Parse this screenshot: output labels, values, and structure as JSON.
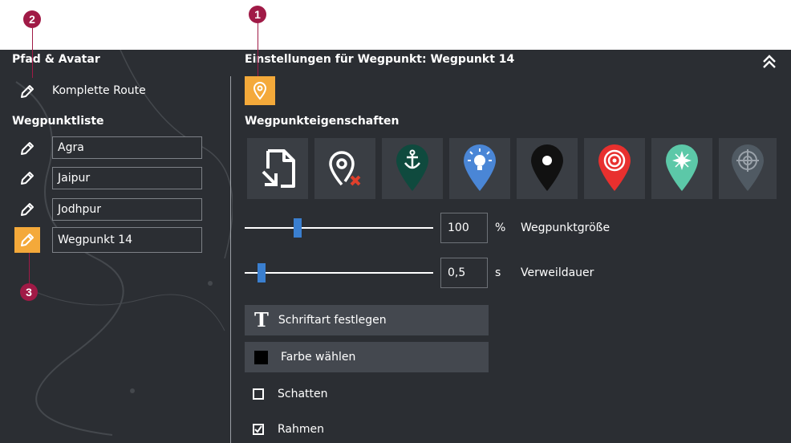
{
  "markers": {
    "m1": "1",
    "m2": "2",
    "m3": "3",
    "color": "#a01a46"
  },
  "left_panel": {
    "title": "Pfad & Avatar",
    "complete_route_label": "Komplette Route",
    "waypoint_list_title": "Wegpunktliste",
    "waypoints": [
      {
        "name": "Agra",
        "active": false
      },
      {
        "name": "Jaipur",
        "active": false
      },
      {
        "name": "Jodhpur",
        "active": false
      },
      {
        "name": "Wegpunkt 14",
        "active": true
      }
    ],
    "edit_icon": "pencil-icon"
  },
  "right_panel": {
    "title": "Einstellungen für Wegpunkt: Wegpunkt 14",
    "collapse_icon": "double-chevron-up-icon",
    "properties_title": "Wegpunkteigenschaften",
    "marker_buttons": [
      {
        "icon": "import-file-icon"
      },
      {
        "icon": "remove-marker-icon"
      },
      {
        "icon": "anchor-pin-icon",
        "color": "#0f4a3e"
      },
      {
        "icon": "lightbulb-pin-icon",
        "color": "#4a86d6"
      },
      {
        "icon": "dot-pin-icon",
        "color": "#111111"
      },
      {
        "icon": "target-pin-icon",
        "color": "#e8302e"
      },
      {
        "icon": "compass-pin-icon",
        "color": "#5cc8a8"
      },
      {
        "icon": "crosshair-pin-icon",
        "color": "#505a63"
      }
    ],
    "size": {
      "value": "100",
      "unit": "%",
      "label": "Wegpunktgröße",
      "slider_fraction": 0.26
    },
    "duration": {
      "value": "0,5",
      "unit": "s",
      "label": "Verweildauer",
      "slider_fraction": 0.07
    },
    "font_button": "Schriftart festlegen",
    "color_button": "Farbe wählen",
    "shadow": {
      "label": "Schatten",
      "checked": false
    },
    "frame": {
      "label": "Rahmen",
      "checked": true
    }
  },
  "colors": {
    "accent": "#f4a93a",
    "panel": "#2b2e33",
    "slider_thumb": "#3a7fd0"
  }
}
